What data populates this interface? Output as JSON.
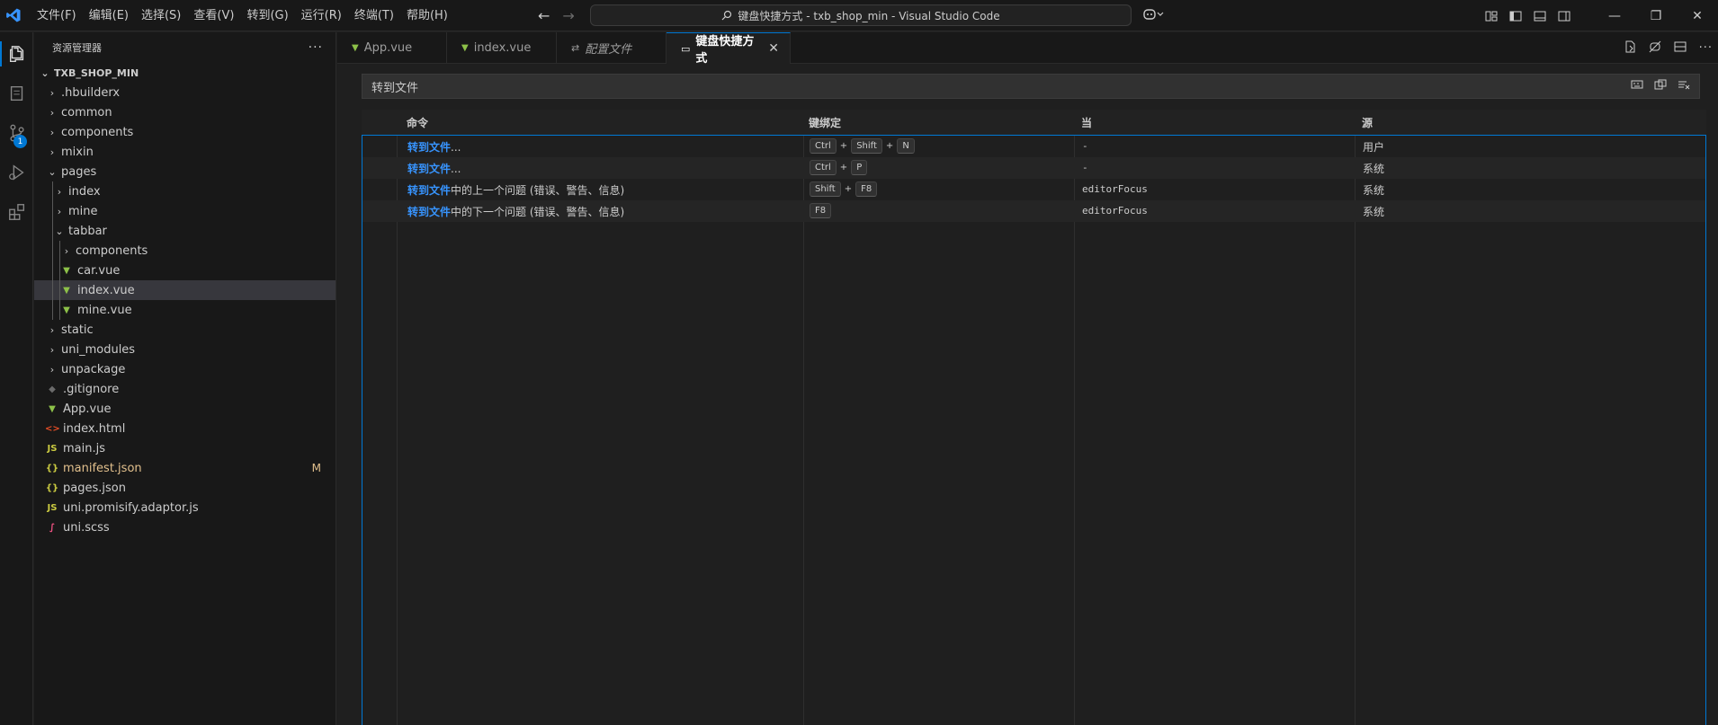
{
  "titlebar": {
    "menu": [
      "文件(F)",
      "编辑(E)",
      "选择(S)",
      "查看(V)",
      "转到(G)",
      "运行(R)",
      "终端(T)",
      "帮助(H)"
    ],
    "command_center": "txb_shop_min - Visual Studio Code",
    "window_title_prefix": "键盘快捷方式"
  },
  "activitybar": {
    "scm_badge": "1"
  },
  "sidebar": {
    "title": "资源管理器",
    "root": "TXB_SHOP_MIN",
    "items": [
      {
        "label": ".hbuilderx",
        "type": "folder",
        "depth": 0,
        "open": false
      },
      {
        "label": "common",
        "type": "folder",
        "depth": 0,
        "open": false
      },
      {
        "label": "components",
        "type": "folder",
        "depth": 0,
        "open": false
      },
      {
        "label": "mixin",
        "type": "folder",
        "depth": 0,
        "open": false
      },
      {
        "label": "pages",
        "type": "folder",
        "depth": 0,
        "open": true
      },
      {
        "label": "index",
        "type": "folder",
        "depth": 1,
        "open": false
      },
      {
        "label": "mine",
        "type": "folder",
        "depth": 1,
        "open": false
      },
      {
        "label": "tabbar",
        "type": "folder",
        "depth": 1,
        "open": true
      },
      {
        "label": "components",
        "type": "folder",
        "depth": 2,
        "open": false
      },
      {
        "label": "car.vue",
        "type": "vue",
        "depth": 2
      },
      {
        "label": "index.vue",
        "type": "vue",
        "depth": 2,
        "selected": true
      },
      {
        "label": "mine.vue",
        "type": "vue",
        "depth": 2
      },
      {
        "label": "static",
        "type": "folder",
        "depth": 0,
        "open": false
      },
      {
        "label": "uni_modules",
        "type": "folder",
        "depth": 0,
        "open": false
      },
      {
        "label": "unpackage",
        "type": "folder",
        "depth": 0,
        "open": false
      },
      {
        "label": ".gitignore",
        "type": "git",
        "depth": 0
      },
      {
        "label": "App.vue",
        "type": "vue",
        "depth": 0
      },
      {
        "label": "index.html",
        "type": "html",
        "depth": 0
      },
      {
        "label": "main.js",
        "type": "js",
        "depth": 0
      },
      {
        "label": "manifest.json",
        "type": "json",
        "depth": 0,
        "modified": "M"
      },
      {
        "label": "pages.json",
        "type": "json",
        "depth": 0
      },
      {
        "label": "uni.promisify.adaptor.js",
        "type": "js",
        "depth": 0
      },
      {
        "label": "uni.scss",
        "type": "scss",
        "depth": 0
      }
    ]
  },
  "tabs": [
    {
      "label": "App.vue",
      "icon": "vue-icon"
    },
    {
      "label": "index.vue",
      "icon": "vue-icon"
    },
    {
      "label": "配置文件",
      "icon": "settings-sliders-icon"
    },
    {
      "label": "键盘快捷方式",
      "icon": "keyboard-icon",
      "active": true
    }
  ],
  "keybindings": {
    "search_value": "转到文件",
    "columns": {
      "command": "命令",
      "keybinding": "键绑定",
      "when": "当",
      "source": "源"
    },
    "rows": [
      {
        "cmd_hl": "转到文件",
        "cmd_rest": "...",
        "keys": [
          "Ctrl",
          "Shift",
          "N"
        ],
        "when": "-",
        "source": "用户"
      },
      {
        "cmd_hl": "转到文件",
        "cmd_rest": "...",
        "keys": [
          "Ctrl",
          "P"
        ],
        "when": "-",
        "source": "系统"
      },
      {
        "cmd_hl": "转到文件",
        "cmd_rest": "中的上一个问题 (错误、警告、信息)",
        "keys": [
          "Shift",
          "F8"
        ],
        "when": "editorFocus",
        "source": "系统"
      },
      {
        "cmd_hl": "转到文件",
        "cmd_rest": "中的下一个问题 (错误、警告、信息)",
        "keys": [
          "F8"
        ],
        "when": "editorFocus",
        "source": "系统"
      }
    ]
  },
  "colors": {
    "accent": "#0078d4",
    "highlight": "#3794ff",
    "vue": "#8dc149",
    "modified": "#e2c08d"
  }
}
